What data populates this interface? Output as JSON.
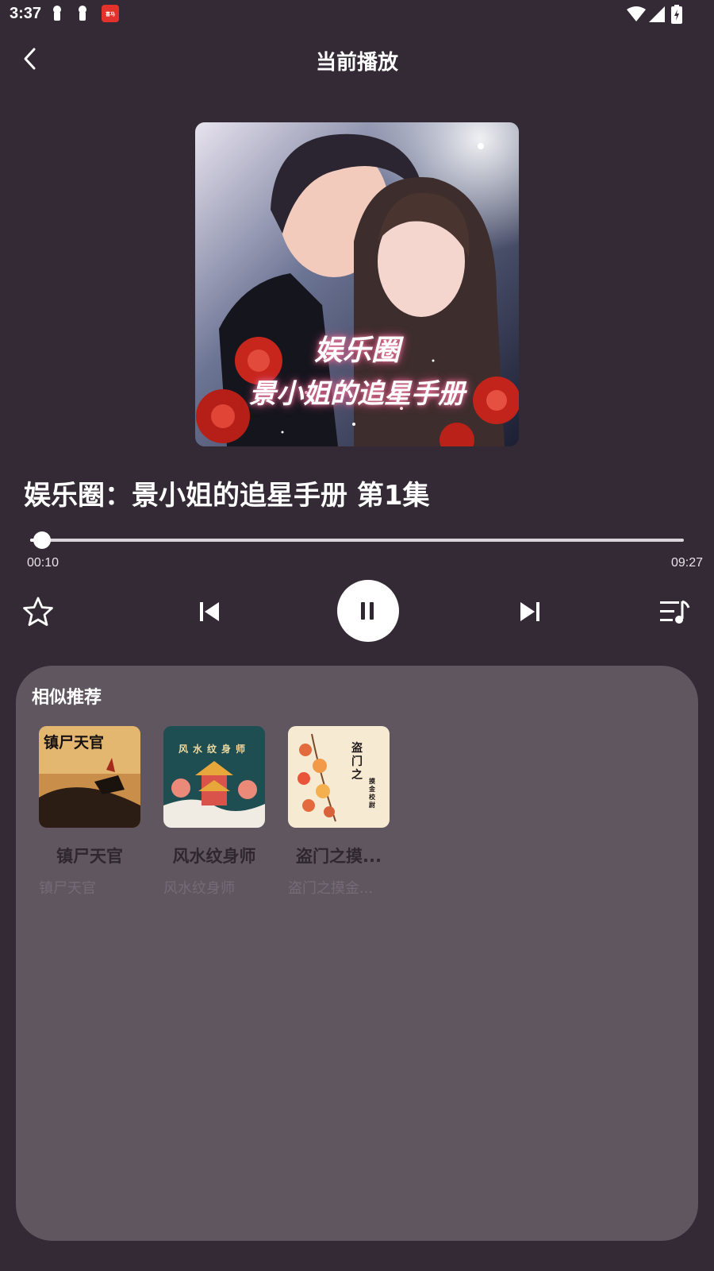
{
  "status_bar": {
    "time": "3:37",
    "app_badge_text": "喜马"
  },
  "header": {
    "title": "当前播放"
  },
  "cover": {
    "line1": "娱乐圈",
    "line2": "景小姐的追星手册"
  },
  "track": {
    "title": "娱乐圈：景小姐的追星手册 第1集",
    "current_time": "00:10",
    "total_time": "09:27",
    "progress_fraction": 0.018
  },
  "controls": {
    "favorite": "star-icon",
    "previous": "skip-previous-icon",
    "pause": "pause-icon",
    "next": "skip-next-icon",
    "playlist": "playlist-icon"
  },
  "recommendations": {
    "title": "相似推荐",
    "items": [
      {
        "name": "镇尸天官",
        "subtitle": "镇尸天官",
        "cover_text": "镇尸天官"
      },
      {
        "name": "风水纹身师",
        "subtitle": "风水纹身师",
        "cover_text": "风水纹身师"
      },
      {
        "name": "盗门之摸...",
        "subtitle": "盗门之摸金...",
        "cover_text_main": "盗门之",
        "cover_text_side": "摸金校尉"
      }
    ]
  },
  "colors": {
    "background": "#342a35",
    "panel": "#605660",
    "accent_white": "#ffffff"
  }
}
